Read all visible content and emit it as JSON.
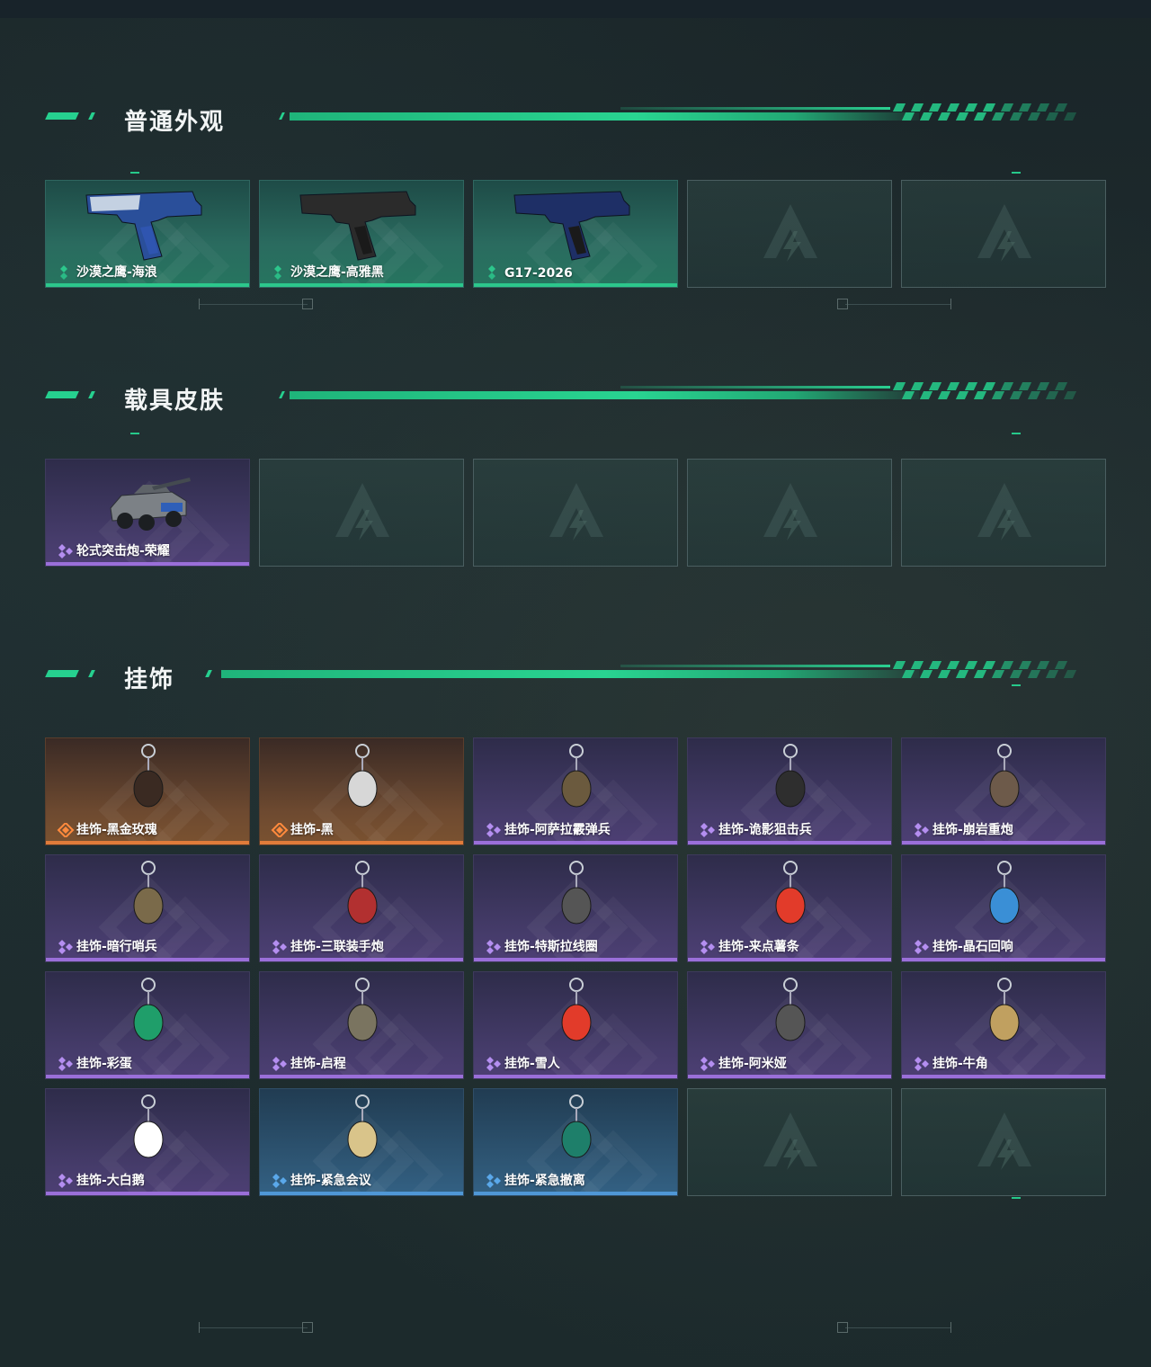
{
  "colors": {
    "accent_green": "#26d08f",
    "rarity_green": "#2cc78c",
    "rarity_purple": "#9a6fd9",
    "rarity_orange": "#e07b3a",
    "rarity_blue": "#4f97d6"
  },
  "sections": [
    {
      "title": "普通外观",
      "items": [
        {
          "label": "沙漠之鹰-海浪",
          "rarity": "green",
          "icon": "pistol-blue-icon"
        },
        {
          "label": "沙漠之鹰-高雅黑",
          "rarity": "green",
          "icon": "pistol-black-icon"
        },
        {
          "label": "G17-2026",
          "rarity": "green",
          "icon": "pistol-navy-icon"
        },
        {
          "label": "",
          "rarity": "empty",
          "icon": "placeholder-logo-icon"
        },
        {
          "label": "",
          "rarity": "empty",
          "icon": "placeholder-logo-icon"
        }
      ]
    },
    {
      "title": "载具皮肤",
      "items": [
        {
          "label": "轮式突击炮-荣耀",
          "rarity": "purple",
          "icon": "armored-vehicle-icon"
        },
        {
          "label": "",
          "rarity": "empty",
          "icon": "placeholder-logo-icon"
        },
        {
          "label": "",
          "rarity": "empty",
          "icon": "placeholder-logo-icon"
        },
        {
          "label": "",
          "rarity": "empty",
          "icon": "placeholder-logo-icon"
        },
        {
          "label": "",
          "rarity": "empty",
          "icon": "placeholder-logo-icon"
        }
      ]
    },
    {
      "title": "挂饰",
      "items": [
        {
          "label": "挂饰-黑金玫瑰",
          "rarity": "orange",
          "icon": "charm-icon"
        },
        {
          "label": "挂饰-黑",
          "rarity": "orange",
          "icon": "charm-icon"
        },
        {
          "label": "挂饰-阿萨拉霰弹兵",
          "rarity": "purple",
          "icon": "charm-icon"
        },
        {
          "label": "挂饰-诡影狙击兵",
          "rarity": "purple",
          "icon": "charm-icon"
        },
        {
          "label": "挂饰-崩岩重炮",
          "rarity": "purple",
          "icon": "charm-icon"
        },
        {
          "label": "挂饰-暗行哨兵",
          "rarity": "purple",
          "icon": "charm-icon"
        },
        {
          "label": "挂饰-三联装手炮",
          "rarity": "purple",
          "icon": "charm-icon"
        },
        {
          "label": "挂饰-特斯拉线圈",
          "rarity": "purple",
          "icon": "charm-icon"
        },
        {
          "label": "挂饰-来点薯条",
          "rarity": "purple",
          "icon": "charm-icon"
        },
        {
          "label": "挂饰-晶石回响",
          "rarity": "purple",
          "icon": "charm-icon"
        },
        {
          "label": "挂饰-彩蛋",
          "rarity": "purple",
          "icon": "charm-icon"
        },
        {
          "label": "挂饰-启程",
          "rarity": "purple",
          "icon": "charm-icon"
        },
        {
          "label": "挂饰-雪人",
          "rarity": "purple",
          "icon": "charm-icon"
        },
        {
          "label": "挂饰-阿米娅",
          "rarity": "purple",
          "icon": "charm-icon"
        },
        {
          "label": "挂饰-牛角",
          "rarity": "purple",
          "icon": "charm-icon"
        },
        {
          "label": "挂饰-大白鹅",
          "rarity": "purple",
          "icon": "charm-icon"
        },
        {
          "label": "挂饰-紧急会议",
          "rarity": "blue",
          "icon": "charm-icon"
        },
        {
          "label": "挂饰-紧急撤离",
          "rarity": "blue",
          "icon": "charm-icon"
        },
        {
          "label": "",
          "rarity": "empty",
          "icon": "placeholder-logo-icon"
        },
        {
          "label": "",
          "rarity": "empty",
          "icon": "placeholder-logo-icon"
        }
      ]
    }
  ]
}
